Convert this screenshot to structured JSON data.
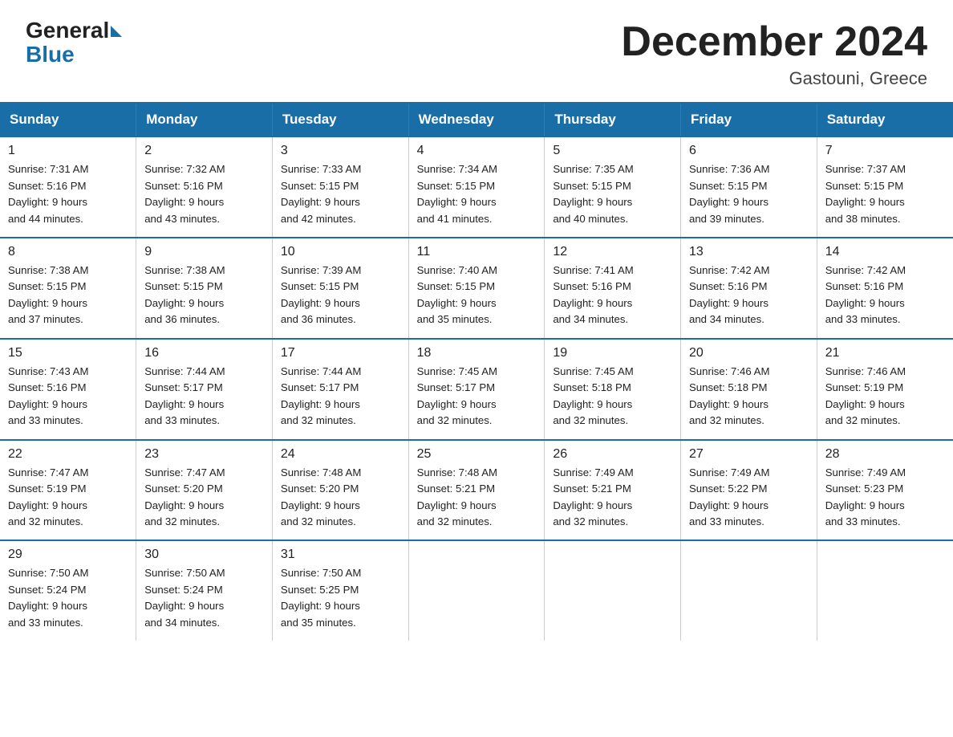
{
  "logo": {
    "general": "General",
    "blue": "Blue"
  },
  "title": "December 2024",
  "location": "Gastouni, Greece",
  "days_of_week": [
    "Sunday",
    "Monday",
    "Tuesday",
    "Wednesday",
    "Thursday",
    "Friday",
    "Saturday"
  ],
  "weeks": [
    [
      {
        "day": "1",
        "sunrise": "7:31 AM",
        "sunset": "5:16 PM",
        "daylight": "9 hours and 44 minutes."
      },
      {
        "day": "2",
        "sunrise": "7:32 AM",
        "sunset": "5:16 PM",
        "daylight": "9 hours and 43 minutes."
      },
      {
        "day": "3",
        "sunrise": "7:33 AM",
        "sunset": "5:15 PM",
        "daylight": "9 hours and 42 minutes."
      },
      {
        "day": "4",
        "sunrise": "7:34 AM",
        "sunset": "5:15 PM",
        "daylight": "9 hours and 41 minutes."
      },
      {
        "day": "5",
        "sunrise": "7:35 AM",
        "sunset": "5:15 PM",
        "daylight": "9 hours and 40 minutes."
      },
      {
        "day": "6",
        "sunrise": "7:36 AM",
        "sunset": "5:15 PM",
        "daylight": "9 hours and 39 minutes."
      },
      {
        "day": "7",
        "sunrise": "7:37 AM",
        "sunset": "5:15 PM",
        "daylight": "9 hours and 38 minutes."
      }
    ],
    [
      {
        "day": "8",
        "sunrise": "7:38 AM",
        "sunset": "5:15 PM",
        "daylight": "9 hours and 37 minutes."
      },
      {
        "day": "9",
        "sunrise": "7:38 AM",
        "sunset": "5:15 PM",
        "daylight": "9 hours and 36 minutes."
      },
      {
        "day": "10",
        "sunrise": "7:39 AM",
        "sunset": "5:15 PM",
        "daylight": "9 hours and 36 minutes."
      },
      {
        "day": "11",
        "sunrise": "7:40 AM",
        "sunset": "5:15 PM",
        "daylight": "9 hours and 35 minutes."
      },
      {
        "day": "12",
        "sunrise": "7:41 AM",
        "sunset": "5:16 PM",
        "daylight": "9 hours and 34 minutes."
      },
      {
        "day": "13",
        "sunrise": "7:42 AM",
        "sunset": "5:16 PM",
        "daylight": "9 hours and 34 minutes."
      },
      {
        "day": "14",
        "sunrise": "7:42 AM",
        "sunset": "5:16 PM",
        "daylight": "9 hours and 33 minutes."
      }
    ],
    [
      {
        "day": "15",
        "sunrise": "7:43 AM",
        "sunset": "5:16 PM",
        "daylight": "9 hours and 33 minutes."
      },
      {
        "day": "16",
        "sunrise": "7:44 AM",
        "sunset": "5:17 PM",
        "daylight": "9 hours and 33 minutes."
      },
      {
        "day": "17",
        "sunrise": "7:44 AM",
        "sunset": "5:17 PM",
        "daylight": "9 hours and 32 minutes."
      },
      {
        "day": "18",
        "sunrise": "7:45 AM",
        "sunset": "5:17 PM",
        "daylight": "9 hours and 32 minutes."
      },
      {
        "day": "19",
        "sunrise": "7:45 AM",
        "sunset": "5:18 PM",
        "daylight": "9 hours and 32 minutes."
      },
      {
        "day": "20",
        "sunrise": "7:46 AM",
        "sunset": "5:18 PM",
        "daylight": "9 hours and 32 minutes."
      },
      {
        "day": "21",
        "sunrise": "7:46 AM",
        "sunset": "5:19 PM",
        "daylight": "9 hours and 32 minutes."
      }
    ],
    [
      {
        "day": "22",
        "sunrise": "7:47 AM",
        "sunset": "5:19 PM",
        "daylight": "9 hours and 32 minutes."
      },
      {
        "day": "23",
        "sunrise": "7:47 AM",
        "sunset": "5:20 PM",
        "daylight": "9 hours and 32 minutes."
      },
      {
        "day": "24",
        "sunrise": "7:48 AM",
        "sunset": "5:20 PM",
        "daylight": "9 hours and 32 minutes."
      },
      {
        "day": "25",
        "sunrise": "7:48 AM",
        "sunset": "5:21 PM",
        "daylight": "9 hours and 32 minutes."
      },
      {
        "day": "26",
        "sunrise": "7:49 AM",
        "sunset": "5:21 PM",
        "daylight": "9 hours and 32 minutes."
      },
      {
        "day": "27",
        "sunrise": "7:49 AM",
        "sunset": "5:22 PM",
        "daylight": "9 hours and 33 minutes."
      },
      {
        "day": "28",
        "sunrise": "7:49 AM",
        "sunset": "5:23 PM",
        "daylight": "9 hours and 33 minutes."
      }
    ],
    [
      {
        "day": "29",
        "sunrise": "7:50 AM",
        "sunset": "5:24 PM",
        "daylight": "9 hours and 33 minutes."
      },
      {
        "day": "30",
        "sunrise": "7:50 AM",
        "sunset": "5:24 PM",
        "daylight": "9 hours and 34 minutes."
      },
      {
        "day": "31",
        "sunrise": "7:50 AM",
        "sunset": "5:25 PM",
        "daylight": "9 hours and 35 minutes."
      },
      null,
      null,
      null,
      null
    ]
  ],
  "labels": {
    "sunrise": "Sunrise:",
    "sunset": "Sunset:",
    "daylight": "Daylight:"
  }
}
